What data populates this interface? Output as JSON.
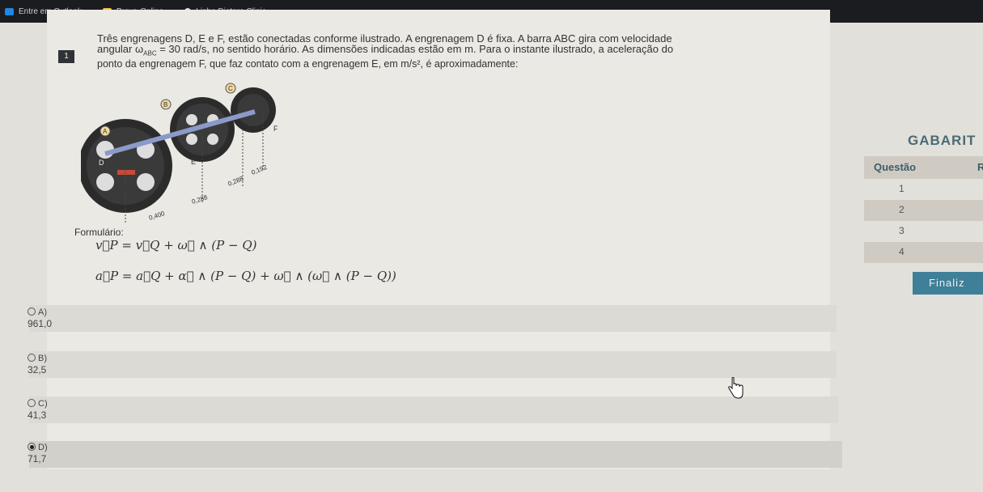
{
  "bookmarks": [
    {
      "label": "Entre em Outlook",
      "icon": "outlook-icon",
      "color": "#1e88e5"
    },
    {
      "label": "Prova-Online",
      "icon": "folder-icon",
      "color": "#f5c242"
    },
    {
      "label": "Linha Dietpro Clinic...",
      "icon": "leaf-icon",
      "color": "#e0e0e0"
    }
  ],
  "question": {
    "number": "1",
    "line1": "Três engrenagens D, E e F, estão conectadas conforme ilustrado. A engrenagem D é fixa. A barra ABC gira com velocidade",
    "line2": "angular ω",
    "line2_sub": "ABC",
    "line2_rest": " = 30 rad/s, no sentido horário. As dimensões indicadas estão em m. Para o instante ilustrado, a aceleração do",
    "line3": "ponto da engrenagem F, que faz contato com a engrenagem E, em m/s², é aproximadamente:",
    "figure_labels": {
      "A": "A",
      "B": "B",
      "C": "C",
      "D": "D",
      "E": "E",
      "F": "F",
      "d1": "0,400",
      "d2": "0,288",
      "d3": "0,288",
      "d4": "0,192"
    },
    "formula_label": "Formulário:",
    "eq1": "v⃗P = v⃗Q + ω⃗ ∧ (P − Q)",
    "eq2": "a⃗P = a⃗Q + α⃗ ∧ (P − Q) + ω⃗ ∧ (ω⃗ ∧ (P − Q))"
  },
  "options": [
    {
      "letter": "A)",
      "value": "961,0",
      "selected": false
    },
    {
      "letter": "B)",
      "value": "32,5",
      "selected": false
    },
    {
      "letter": "C)",
      "value": "41,3",
      "selected": false
    },
    {
      "letter": "D)",
      "value": "71,7",
      "selected": true
    }
  ],
  "gabarito": {
    "title": "GABARIT",
    "col_questao": "Questão",
    "col_r": "R",
    "rows": [
      "1",
      "2",
      "3",
      "4"
    ]
  },
  "finaliza_label": "Finaliz",
  "colors": {
    "accent": "#3f7f98",
    "bar": "#1b1c20",
    "row_alt": "#cfcbc3"
  }
}
